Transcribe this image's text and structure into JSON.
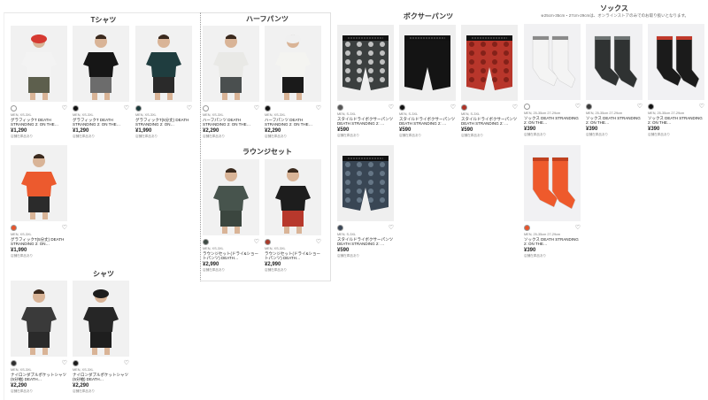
{
  "sections": {
    "tshirts": {
      "title": "Tシャツ",
      "items": [
        {
          "size": "MEN, XS-3XL",
          "name": "グラフィックT DEATH STRANDING 2: ON THE…",
          "price": "¥1,290",
          "note": "店舗在庫品あり",
          "swatch": "#ffffff",
          "shirt": "#f3f3f3",
          "pants": "#5d5f4d",
          "hat": "#d63a32"
        },
        {
          "size": "MEN, XS-3XL",
          "name": "グラフィックT DEATH STRANDING 2: ON THE…",
          "price": "¥1,290",
          "note": "店舗在庫品あり",
          "swatch": "#111111",
          "shirt": "#161616",
          "pants": "#6c6c6c",
          "hat": ""
        },
        {
          "size": "MEN, XS-3XL",
          "name": "グラフィックT(5分丈) DEATH STRANDING 2: ON…",
          "price": "¥1,990",
          "note": "店舗在庫品あり",
          "swatch": "#1b3a3a",
          "shirt": "#1f3d3f",
          "pants": "#2a2a2a",
          "hat": ""
        },
        {
          "size": "MEN, XS-3XL",
          "name": "グラフィックT(5分丈) DEATH STRANDING 2: ON…",
          "price": "¥1,990",
          "note": "店舗在庫品あり",
          "swatch": "#e8552c",
          "shirt": "#ec5a2e",
          "pants": "#2b2b2b",
          "hat": ""
        }
      ]
    },
    "shirts": {
      "title": "シャツ",
      "items": [
        {
          "size": "MEN, XS-3XL",
          "name": "ナイロンダブルポケットシャツ(5分袖) DEATH…",
          "price": "¥2,290",
          "note": "店舗在庫品あり",
          "swatch": "#2e2e2e",
          "shirt": "#3a3a3a",
          "pants": "#2a2a2a",
          "hat": ""
        },
        {
          "size": "MEN, XS-3XL",
          "name": "ナイロンダブルポケットシャツ(5分袖) DEATH…",
          "price": "¥2,290",
          "note": "店舗在庫品あり",
          "swatch": "#1a1a1a",
          "shirt": "#262626",
          "pants": "#1e1e1e",
          "hat": "#1c1c1c"
        }
      ]
    },
    "shorts": {
      "title": "ハーフパンツ",
      "items": [
        {
          "size": "MEN, XS-3XL",
          "name": "ハーフパンツ DEATH STRANDING 2: ON THE…",
          "price": "¥2,290",
          "note": "店舗在庫品あり",
          "swatch": "#ffffff",
          "shirt": "#e9e9e6",
          "pants": "#4a4f4f",
          "hat": ""
        },
        {
          "size": "MEN, XS-3XL",
          "name": "ハーフパンツ DEATH STRANDING 2: ON THE…",
          "price": "¥2,290",
          "note": "店舗在庫品あり",
          "swatch": "#111111",
          "shirt": "#f4f4f1",
          "pants": "#1a1a1a",
          "hat": "#f0f0f0"
        }
      ]
    },
    "lounge": {
      "title": "ラウンジセット",
      "items": [
        {
          "size": "MEN, XS-3XL",
          "name": "ラウンジセット(ドライ&ショートパンツ) DEATH…",
          "price": "¥2,990",
          "note": "店舗在庫品あり",
          "swatch": "#3e4a44",
          "shirt": "#47544d",
          "pants": "#3b463f",
          "hat": ""
        },
        {
          "size": "MEN, XS-3XL",
          "name": "ラウンジセット(ドライ&ショートパンツ) DEATH…",
          "price": "¥2,990",
          "note": "店舗在庫品あり",
          "swatch": "#a83a2a",
          "shirt": "#1d1d1d",
          "pants": "#b7382c",
          "hat": ""
        }
      ]
    },
    "boxers": {
      "title": "ボクサーパンツ",
      "items": [
        {
          "size": "MEN, S-3XL",
          "name": "スタイルドライボクサーパンツ DEATH STRANDING 2: …",
          "price": "¥590",
          "note": "店舗在庫品あり",
          "swatch": "#555555",
          "color": "#3b3f3f",
          "pattern": "#d8d8d8"
        },
        {
          "size": "MEN, S-3XL",
          "name": "スタイルドライボクサーパンツ DEATH STRANDING 2: …",
          "price": "¥590",
          "note": "店舗在庫品あり",
          "swatch": "#111111",
          "color": "#141414",
          "pattern": ""
        },
        {
          "size": "MEN, S-3XL",
          "name": "スタイルドライボクサーパンツ DEATH STRANDING 2: …",
          "price": "¥590",
          "note": "店舗在庫品あり",
          "swatch": "#b03226",
          "color": "#b8362b",
          "pattern": "#7a1d16"
        },
        {
          "size": "MEN, S-3XL",
          "name": "スタイルドライボクサーパンツ DEATH STRANDING 2: …",
          "price": "¥590",
          "note": "店舗在庫品あり",
          "swatch": "#3a4656",
          "color": "#394654",
          "pattern": "#6d7f8f"
        }
      ]
    },
    "socks": {
      "title": "ソックス",
      "subtitle": "※25cm-35cm・27cm-29cmは、オンラインストアのみでのお取り扱いとなります。",
      "items": [
        {
          "size": "MEN, 25-35cm 27-29cm",
          "name": "ソックス DEATH STRANDING 2: ON THE…",
          "price": "¥390",
          "note": "店舗在庫品あり",
          "swatch": "#ffffff",
          "color": "#f4f4f4",
          "accent": "#8a8a8a"
        },
        {
          "size": "MEN, 25-35cm 27-29cm",
          "name": "ソックス DEATH STRANDING 2: ON THE…",
          "price": "¥390",
          "note": "店舗在庫品あり",
          "swatch": "#3a3a3a",
          "color": "#2f3232",
          "accent": "#6e7474"
        },
        {
          "size": "MEN, 25-35cm 27-29cm",
          "name": "ソックス DEATH STRANDING 2: ON THE…",
          "price": "¥390",
          "note": "店舗在庫品あり",
          "swatch": "#111111",
          "color": "#1b1b1b",
          "accent": "#c0392b"
        },
        {
          "size": "MEN, 25-35cm 27-29cm",
          "name": "ソックス DEATH STRANDING 2: ON THE…",
          "price": "¥390",
          "note": "店舗在庫品あり",
          "swatch": "#e8552c",
          "color": "#ee5a2c",
          "accent": "#c0401f"
        }
      ]
    }
  },
  "icons": {
    "favorite": "♡"
  }
}
